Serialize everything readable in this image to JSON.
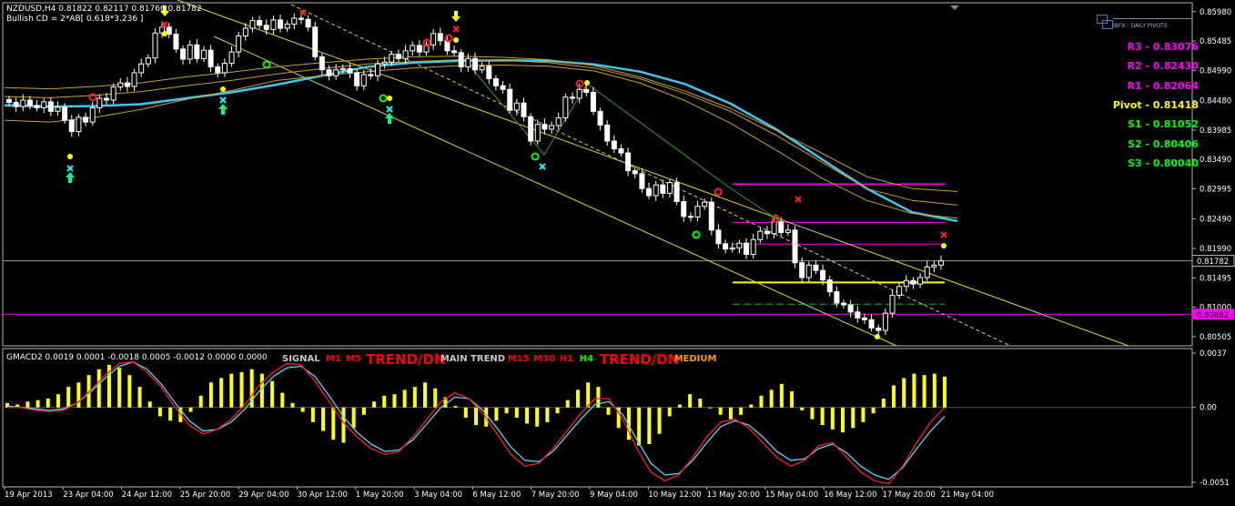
{
  "header": {
    "symbol_line": "NZDUSD,H4  0.81822 0.82117 0.81766 0.81782",
    "pattern_line": "Bullish CD = 2*AB[ 0.618*3.236 ]"
  },
  "logo_text": "IBFX - DAILY PIVOTS",
  "pivots": [
    {
      "label": "R3 - 0.83076",
      "value": 0.83076,
      "color": "#ff00ff"
    },
    {
      "label": "R2 - 0.82430",
      "value": 0.8243,
      "color": "#ff00ff"
    },
    {
      "label": "R1 - 0.82064",
      "value": 0.82064,
      "color": "#ff00ff"
    },
    {
      "label": "Pivot - 0.81418",
      "value": 0.81418,
      "color": "#ffff00"
    },
    {
      "label": "S1 - 0.81052",
      "value": 0.81052,
      "color": "#00ff00"
    },
    {
      "label": "S2 - 0.80406",
      "value": 0.80406,
      "color": "#00ff00"
    },
    {
      "label": "S3 - 0.80040",
      "value": 0.8004,
      "color": "#00ff00"
    }
  ],
  "price_axis": {
    "ticks": [
      "0.85980",
      "0.85485",
      "0.84990",
      "0.84480",
      "0.83985",
      "0.83490",
      "0.82995",
      "0.82490",
      "0.81990",
      "0.81495",
      "0.81000",
      "0.80505"
    ],
    "current_price": "0.81782",
    "magenta_price": "0.80882"
  },
  "time_axis": {
    "labels": [
      "19 Apr 2013",
      "23 Apr 04:00",
      "24 Apr 12:00",
      "25 Apr 20:00",
      "29 Apr 04:00",
      "30 Apr 12:00",
      "1 May 20:00",
      "3 May 04:00",
      "6 May 12:00",
      "7 May 20:00",
      "9 May 04:00",
      "10 May 12:00",
      "13 May 20:00",
      "15 May 04:00",
      "16 May 12:00",
      "17 May 20:00",
      "21 May 04:00"
    ]
  },
  "indicator": {
    "title": "GMACD2 0.0019 0.0001 -0.0018 0.0005 -0.0012 0.0000 0.0000",
    "axis_ticks": [
      "0.0037",
      "0.00",
      "-0.0051"
    ],
    "signal_panel": [
      {
        "text": "SIGNAL",
        "color": "#c8c8c8",
        "size": "small"
      },
      {
        "text": "M1",
        "color": "#ff0000",
        "size": "small"
      },
      {
        "text": "M5",
        "color": "#ff0000",
        "size": "small"
      },
      {
        "text": "TREND/DN",
        "color": "#ff0000",
        "size": "large"
      },
      {
        "text": "MAIN TREND",
        "color": "#c8c8c8",
        "size": "small"
      },
      {
        "text": "M15",
        "color": "#ff0000",
        "size": "small"
      },
      {
        "text": "M30",
        "color": "#ff0000",
        "size": "small"
      },
      {
        "text": "H1",
        "color": "#ff0000",
        "size": "small"
      },
      {
        "text": "H4",
        "color": "#00ff00",
        "size": "small"
      },
      {
        "text": "TREND/DN",
        "color": "#ff0000",
        "size": "large"
      },
      {
        "text": "MEDIUM",
        "color": "#ff9900",
        "size": "small"
      }
    ]
  },
  "chart_data": {
    "type": "candlestick",
    "symbol": "NZDUSD",
    "timeframe": "H4",
    "ylim": [
      0.8035,
      0.8613
    ],
    "last": {
      "open": 0.81822,
      "high": 0.82117,
      "low": 0.81766,
      "close": 0.81782
    },
    "closes": [
      0.8445,
      0.8438,
      0.8449,
      0.844,
      0.8436,
      0.8446,
      0.843,
      0.8437,
      0.8415,
      0.8396,
      0.842,
      0.8412,
      0.8436,
      0.8452,
      0.8449,
      0.8471,
      0.8478,
      0.8472,
      0.8495,
      0.851,
      0.852,
      0.8562,
      0.8572,
      0.856,
      0.8535,
      0.8518,
      0.8542,
      0.8519,
      0.8533,
      0.8505,
      0.8495,
      0.8511,
      0.853,
      0.8557,
      0.857,
      0.8583,
      0.8575,
      0.8568,
      0.8584,
      0.857,
      0.8577,
      0.8587,
      0.8585,
      0.8572,
      0.8522,
      0.85,
      0.849,
      0.85,
      0.8502,
      0.8495,
      0.8473,
      0.8492,
      0.849,
      0.851,
      0.8513,
      0.8526,
      0.8519,
      0.8532,
      0.8541,
      0.853,
      0.8542,
      0.8561,
      0.8549,
      0.8532,
      0.8529,
      0.8505,
      0.8519,
      0.85,
      0.8506,
      0.8485,
      0.8473,
      0.8467,
      0.8432,
      0.8444,
      0.8421,
      0.838,
      0.8408,
      0.84,
      0.8406,
      0.8419,
      0.8454,
      0.8452,
      0.8467,
      0.8462,
      0.843,
      0.8407,
      0.838,
      0.8367,
      0.836,
      0.833,
      0.8325,
      0.83,
      0.8288,
      0.8306,
      0.8292,
      0.831,
      0.8278,
      0.8253,
      0.8252,
      0.827,
      0.8277,
      0.823,
      0.8207,
      0.8198,
      0.82,
      0.8208,
      0.8189,
      0.8214,
      0.8228,
      0.8224,
      0.8244,
      0.8226,
      0.823,
      0.8175,
      0.815,
      0.8171,
      0.8162,
      0.8146,
      0.8126,
      0.8107,
      0.8104,
      0.8092,
      0.8082,
      0.8079,
      0.8065,
      0.8061,
      0.809,
      0.812,
      0.8135,
      0.8145,
      0.8139,
      0.815,
      0.8168,
      0.8171,
      0.8178
    ],
    "pivot_levels": {
      "R3": 0.83076,
      "R2": 0.8243,
      "R1": 0.82064,
      "Pivot": 0.81418,
      "S1": 0.81052,
      "S2": 0.80406,
      "S3": 0.8004
    },
    "ma_series": [
      {
        "name": "cyan",
        "color": "#3cc8f0",
        "values": [
          0.844,
          0.8438,
          0.8439,
          0.8442,
          0.8452,
          0.8462,
          0.8475,
          0.849,
          0.8505,
          0.8512,
          0.8515,
          0.8516,
          0.8515,
          0.8509,
          0.8497,
          0.8476,
          0.8443,
          0.84,
          0.835,
          0.83,
          0.826,
          0.8245
        ]
      },
      {
        "name": "gold-1",
        "color": "#c8a030",
        "values": [
          0.847,
          0.8468,
          0.8472,
          0.8478,
          0.8488,
          0.8496,
          0.8505,
          0.8512,
          0.8518,
          0.8522,
          0.8523,
          0.8521,
          0.8517,
          0.8507,
          0.8488,
          0.8464,
          0.8435,
          0.8398,
          0.836,
          0.832,
          0.83,
          0.8295
        ]
      },
      {
        "name": "gold-2",
        "color": "#c8a030",
        "values": [
          0.8455,
          0.8453,
          0.8457,
          0.8463,
          0.8473,
          0.8482,
          0.8493,
          0.8502,
          0.851,
          0.8514,
          0.8517,
          0.8516,
          0.8512,
          0.8503,
          0.8485,
          0.846,
          0.843,
          0.839,
          0.8345,
          0.83,
          0.828,
          0.8272
        ]
      },
      {
        "name": "gold-3",
        "color": "#c8a030",
        "values": [
          0.8415,
          0.8412,
          0.842,
          0.8433,
          0.845,
          0.8465,
          0.8482,
          0.849,
          0.8497,
          0.8503,
          0.8507,
          0.8508,
          0.8506,
          0.8498,
          0.8478,
          0.8448,
          0.841,
          0.8365,
          0.8318,
          0.828,
          0.8258,
          0.825
        ]
      }
    ],
    "histogram": [
      0.0003,
      0.0002,
      0.0004,
      0.0005,
      0.0006,
      0.0009,
      0.0014,
      0.0017,
      0.0022,
      0.0026,
      0.0029,
      0.0027,
      0.0022,
      0.0014,
      0.0004,
      -0.0006,
      -0.0009,
      -0.001,
      -0.0003,
      0.0008,
      0.0017,
      0.002,
      0.0023,
      0.0024,
      0.0026,
      0.0023,
      0.0018,
      0.001,
      0.0003,
      -0.0003,
      -0.001,
      -0.0016,
      -0.0022,
      -0.0024,
      -0.0014,
      -0.0005,
      0.0004,
      0.0008,
      0.0009,
      0.0012,
      0.0014,
      0.0017,
      0.0013,
      0.0007,
      0.0001,
      -0.0007,
      -0.0012,
      -0.0013,
      -0.0009,
      -0.0004,
      -0.0007,
      -0.0011,
      -0.0013,
      -0.001,
      -0.0004,
      0.0005,
      0.0012,
      0.0017,
      0.0014,
      -0.0005,
      -0.0014,
      -0.0022,
      -0.0026,
      -0.0025,
      -0.0018,
      -0.0006,
      0.0002,
      0.0009,
      0.0006,
      0.0,
      -0.0005,
      -0.0008,
      -0.0005,
      0.0002,
      0.0008,
      0.0012,
      0.0016,
      0.0011,
      -0.0002,
      -0.0008,
      -0.0012,
      -0.0015,
      -0.0017,
      -0.0014,
      -0.001,
      -0.0004,
      0.0006,
      0.0015,
      0.002,
      0.0023,
      0.0022,
      0.0023,
      0.0021
    ],
    "macd_red": [
      0.0,
      0.0,
      -0.0002,
      -0.0003,
      -0.0002,
      0.0003,
      0.0012,
      0.0022,
      0.003,
      0.0031,
      0.0024,
      0.0014,
      0.0,
      -0.0012,
      -0.0018,
      -0.0015,
      -0.0008,
      0.0002,
      0.0015,
      0.0024,
      0.003,
      0.0029,
      0.0018,
      0.0004,
      -0.001,
      -0.002,
      -0.0028,
      -0.0032,
      -0.003,
      -0.002,
      -0.0008,
      0.0004,
      0.001,
      0.0006,
      -0.0004,
      -0.0018,
      -0.0032,
      -0.004,
      -0.0038,
      -0.0028,
      -0.0016,
      -0.0004,
      0.0006,
      0.0006,
      -0.0008,
      -0.0028,
      -0.0044,
      -0.005,
      -0.0046,
      -0.0034,
      -0.002,
      -0.001,
      -0.0008,
      -0.0014,
      -0.0024,
      -0.0034,
      -0.004,
      -0.0036,
      -0.0026,
      -0.0024,
      -0.0034,
      -0.0044,
      -0.005,
      -0.0052,
      -0.004,
      -0.0024,
      -0.001,
      0.0
    ],
    "macd_cyan": [
      0.0001,
      0.0,
      -0.0001,
      -0.0002,
      -0.0001,
      0.0003,
      0.0011,
      0.002,
      0.0028,
      0.0031,
      0.0026,
      0.0016,
      0.0003,
      -0.0009,
      -0.0016,
      -0.0015,
      -0.001,
      -0.0001,
      0.0011,
      0.0021,
      0.0027,
      0.0028,
      0.0021,
      0.0008,
      -0.0006,
      -0.0017,
      -0.0025,
      -0.003,
      -0.0029,
      -0.0022,
      -0.0011,
      0.0,
      0.0007,
      0.0006,
      -0.0002,
      -0.0014,
      -0.0027,
      -0.0036,
      -0.0037,
      -0.003,
      -0.0019,
      -0.0008,
      0.0002,
      0.0004,
      -0.0005,
      -0.0022,
      -0.0038,
      -0.0046,
      -0.0045,
      -0.0036,
      -0.0024,
      -0.0013,
      -0.0009,
      -0.0012,
      -0.002,
      -0.003,
      -0.0036,
      -0.0035,
      -0.0028,
      -0.0025,
      -0.0031,
      -0.004,
      -0.0046,
      -0.0049,
      -0.0041,
      -0.0028,
      -0.0016,
      -0.0006
    ]
  }
}
